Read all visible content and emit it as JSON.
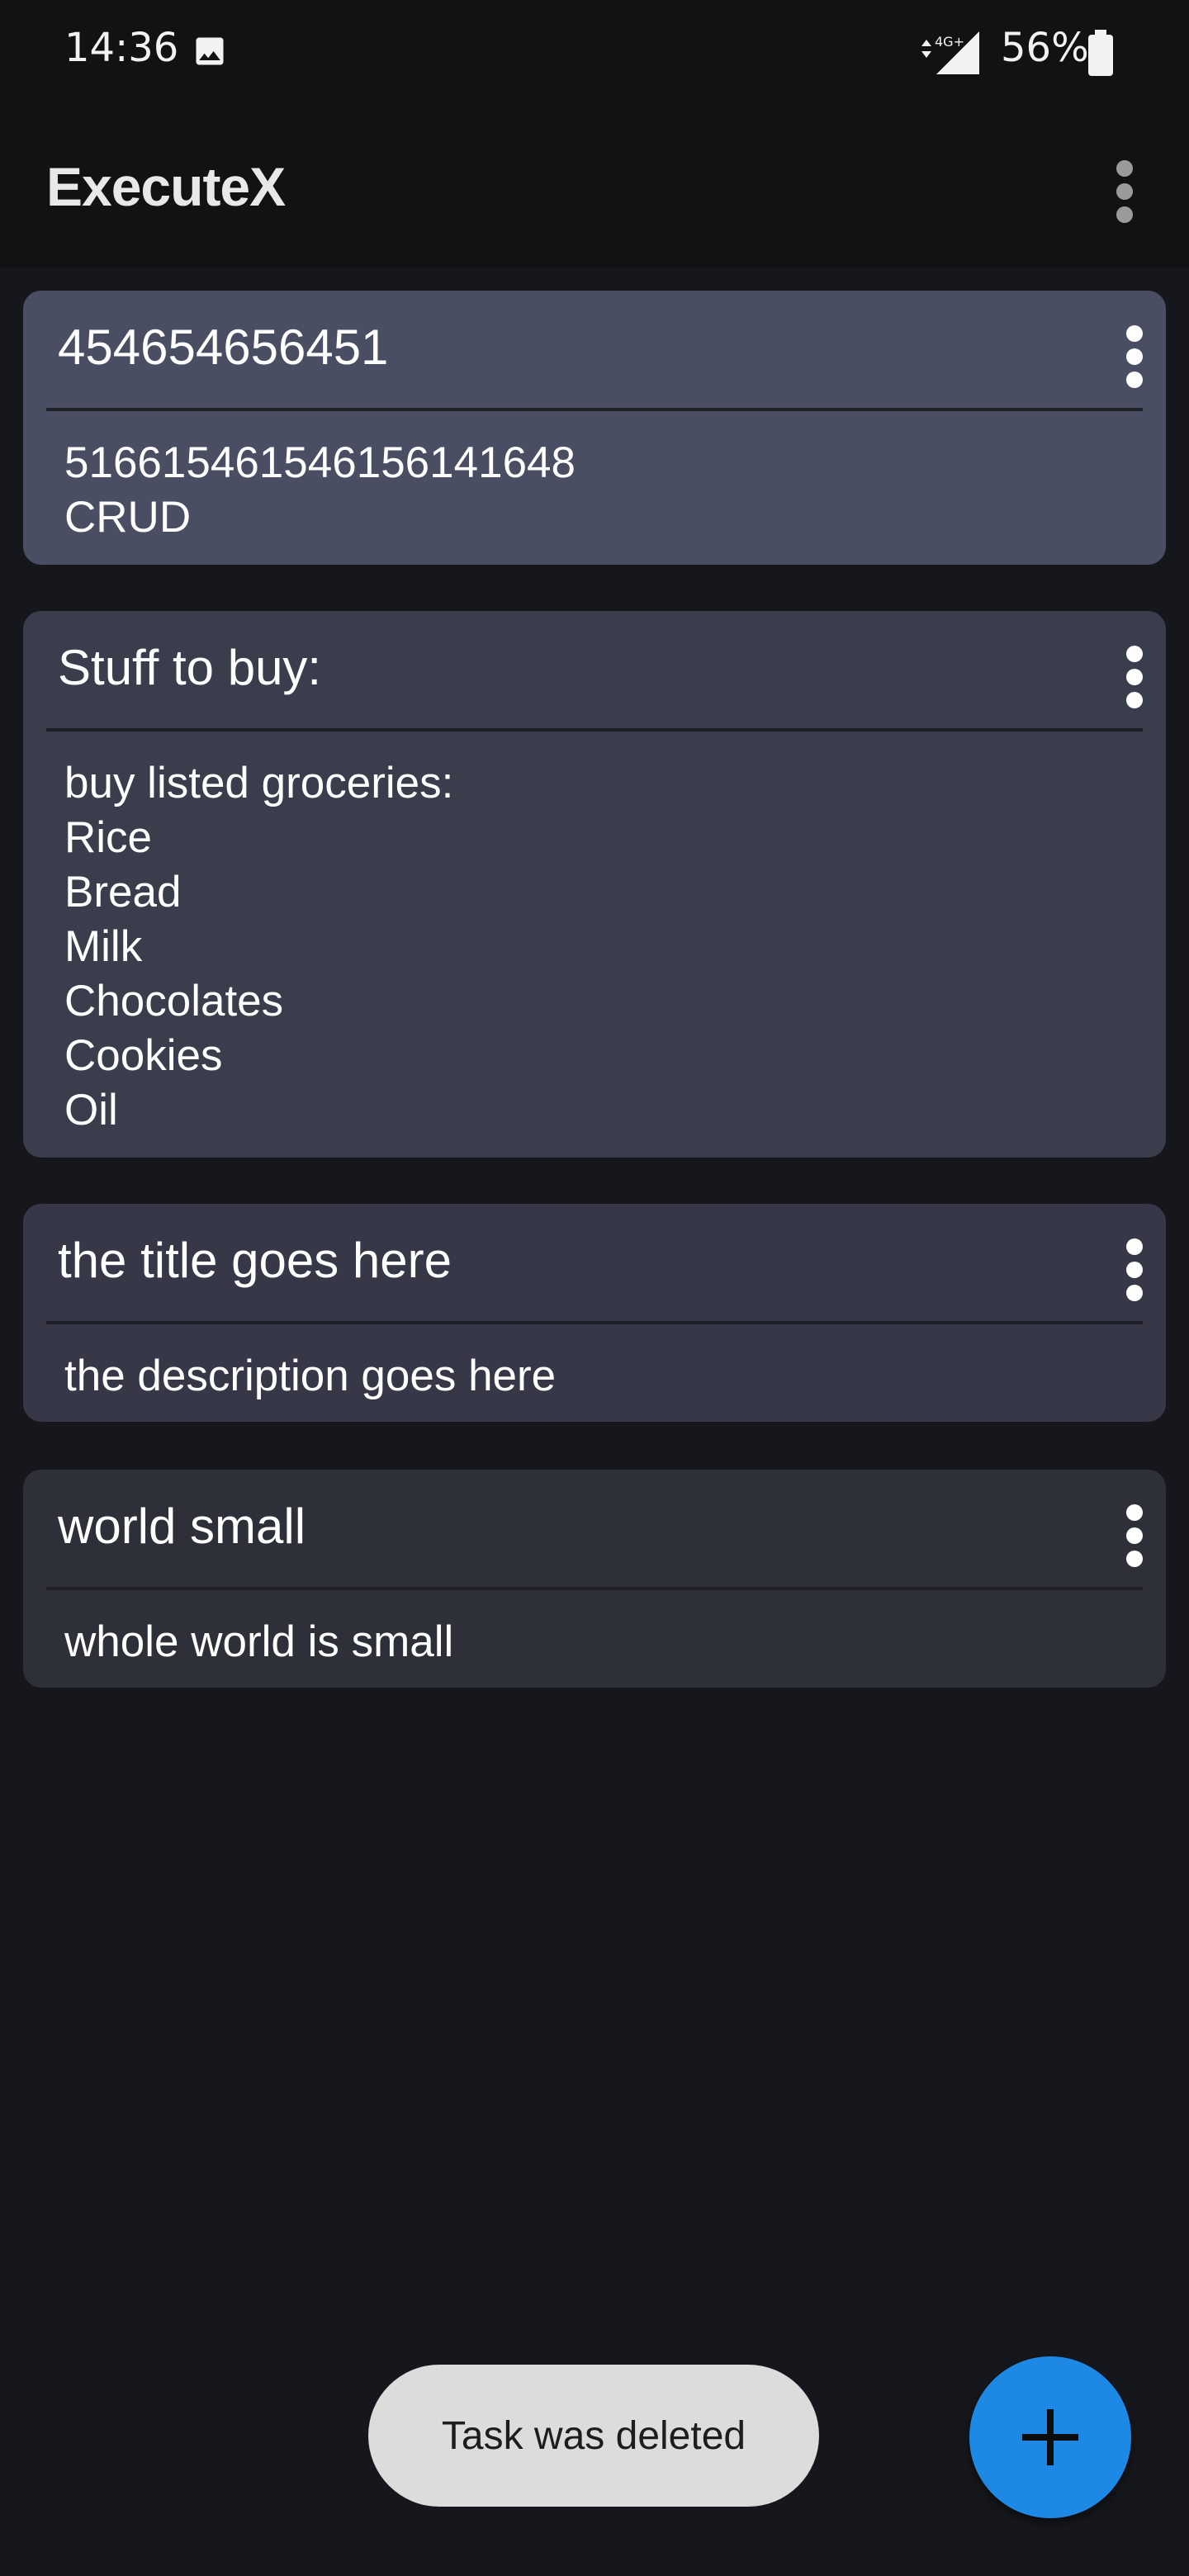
{
  "status_bar": {
    "time": "14:36",
    "network": "4G+",
    "battery": "56%",
    "icons": [
      "image-icon",
      "signal-icon",
      "battery-icon"
    ]
  },
  "app_bar": {
    "title": "ExecuteX",
    "menu_icon": "more-vert-icon"
  },
  "tasks": [
    {
      "title": "454654656451",
      "description": "5166154615461561416​48\nCRUD",
      "color": "#4a4e63"
    },
    {
      "title": "Stuff to buy:",
      "description": "buy listed groceries:\nRice\nBread\nMilk\nChocolates\nCookies\nOil",
      "color": "#3a3d4b"
    },
    {
      "title": "the title goes here",
      "description": "the description goes here",
      "color": "#363847"
    },
    {
      "title": "world small",
      "description": "whole world is small",
      "color": "#2e3039"
    }
  ],
  "snackbar": {
    "message": "Task was deleted"
  },
  "fab": {
    "icon": "add-icon",
    "color": "#1e88e5"
  },
  "colors": {
    "background": "#16171c",
    "app_bar": "#111214"
  }
}
